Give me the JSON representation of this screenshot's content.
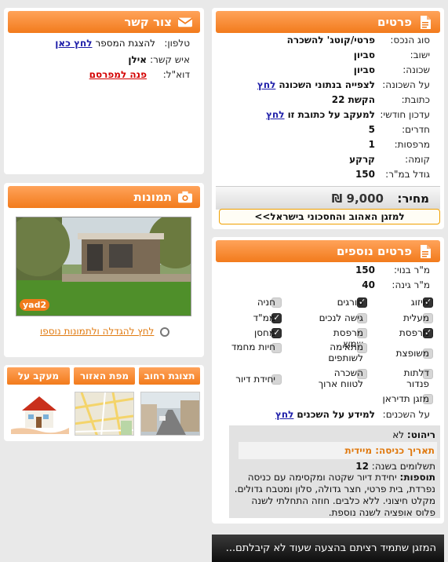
{
  "details": {
    "title": "פרטים",
    "rows": [
      {
        "label": "סוג הנכס:",
        "value": "פרטי/קוטג' להשכרה"
      },
      {
        "label": "ישוב:",
        "value": "סביון"
      },
      {
        "label": "שכונה:",
        "value": "סביון"
      },
      {
        "label": "על השכונה:",
        "value": "לצפייה בנתוני השכונה",
        "link": "לחץ"
      },
      {
        "label": "כתובת:",
        "value": "הקשת 22"
      },
      {
        "label": "עדכון חודשי:",
        "value": "למעקב על כתובת זו",
        "link": "לחץ"
      },
      {
        "label": "חדרים:",
        "value": "5"
      },
      {
        "label": "מרפסות:",
        "value": "1"
      },
      {
        "label": "קומה:",
        "value": "קרקע"
      },
      {
        "label": "גודל במ\"ר:",
        "value": "150"
      }
    ],
    "price_label": "מחיר:",
    "price_value": "9,000 ₪",
    "ac_banner": "למזגן האהוב והחסכוני בישראל>>"
  },
  "more": {
    "title": "פרטים נוספים",
    "built_label": "מ\"ר בנוי:",
    "built_value": "150",
    "garden_label": "מ\"ר גינה:",
    "garden_value": "40",
    "features": [
      {
        "label": "מיזוג",
        "checked": true
      },
      {
        "label": "סורגים",
        "checked": true
      },
      {
        "label": "חניה",
        "checked": false
      },
      {
        "label": "מעלית",
        "checked": false
      },
      {
        "label": "גישה לנכים",
        "checked": false
      },
      {
        "label": "ממ\"ד",
        "checked": true
      },
      {
        "label": "מרפסת",
        "checked": true
      },
      {
        "label": "מרפסת שמש",
        "checked": false
      },
      {
        "label": "מחסן",
        "checked": true
      },
      {
        "label": "משופצת",
        "checked": false
      },
      {
        "label": "מתאימה לשותפים",
        "checked": false
      },
      {
        "label": "חיות מחמד",
        "checked": false
      },
      {
        "label": "דלתות פנדור",
        "checked": false
      },
      {
        "label": "השכרה לטווח ארוך",
        "checked": false
      },
      {
        "label": "יחידת דיור",
        "checked": false
      },
      {
        "label": "מזגן תדיראן",
        "checked": false
      }
    ],
    "tenants_label": "על השכנים:",
    "tenants_value": "למידע על השכנים",
    "tenants_link": "לחץ",
    "furniture_label": "ריהוט:",
    "furniture_value": "לא",
    "entry_date": "תאריך כניסה: מיידית",
    "payments_label": "תשלומים בשנה:",
    "payments_value": "12",
    "extras_label": "תוספות:",
    "extras_text": "יחידת דיור שקטה ומקסימה עם כניסה נפרדת, בית פרטי, חצר גדולה, סלון ומטבח גדולים. מקלט חיצוני. ללא כלבים. חוזה התחלתי לשנה פלוס אופציה לשנה נוספת."
  },
  "bottom_banner": "המזגן שתמיד רציתם בהצעה שעוד לא קיבלתם...",
  "contact": {
    "title": "צור קשר",
    "phone_label": "טלפון:",
    "phone_value": "להצגת המספר",
    "phone_link": "לחץ כאן",
    "person_label": "איש קשר:",
    "person_value": "אילן",
    "email_label": "דוא\"ל:",
    "email_link": "פנה למפרסם"
  },
  "photos": {
    "title": "תמונות",
    "watermark": "yad2",
    "enlarge_link": "לחץ להגדלה ולתמונות נוספו"
  },
  "tabs": [
    {
      "label": "תצוגת רחוב"
    },
    {
      "label": "מפת האזור"
    },
    {
      "label": "מעקב על בניינים"
    }
  ],
  "colors": {
    "accent": "#f27b1c",
    "link": "#1c1ca8",
    "red": "#d40000"
  }
}
